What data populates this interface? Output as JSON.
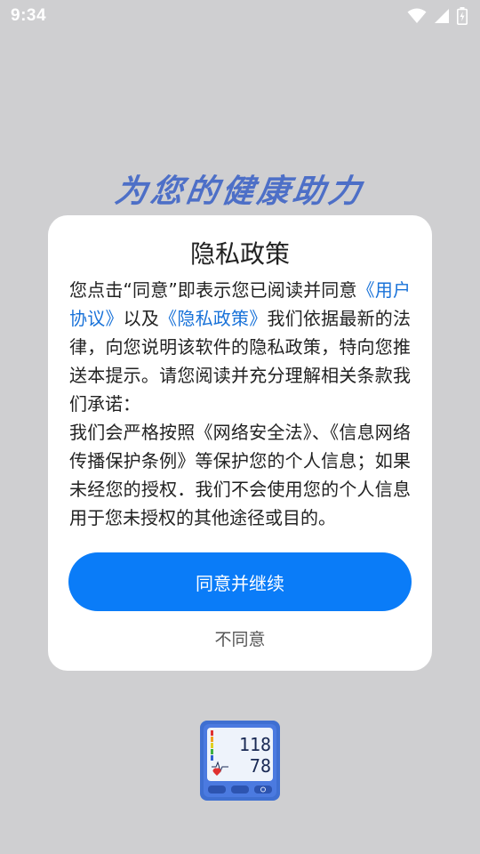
{
  "status_bar": {
    "time": "9:34"
  },
  "slogan": "为您的健康助力",
  "dialog": {
    "title": "隐私政策",
    "body": {
      "part1": "您点击“同意”即表示您已阅读并同意",
      "user_agreement_link": "《用户协议》",
      "part2": "以及",
      "privacy_link": "《隐私政策》",
      "part3": "我们依据最新的法律，向您说明该软件的隐私政策，特向您推送本提示。请您阅读并充分理解相关条款我们承诺：",
      "part4": "我们会严格按照《网络安全法》、《信息网络传播保护条例》等保护您的个人信息；如果未经您的授权．我们不会使用您的个人信息用于您未授权的其他途径或目的。"
    },
    "agree_button": "同意并继续",
    "disagree_button": "不同意"
  },
  "app_icon": {
    "name": "blood-pressure-monitor-icon",
    "systolic": "118",
    "diastolic": "78"
  },
  "colors": {
    "background": "#cfcfd1",
    "primary": "#0a7cf8",
    "link": "#1a73d9",
    "slogan": "#4d6fc7"
  }
}
